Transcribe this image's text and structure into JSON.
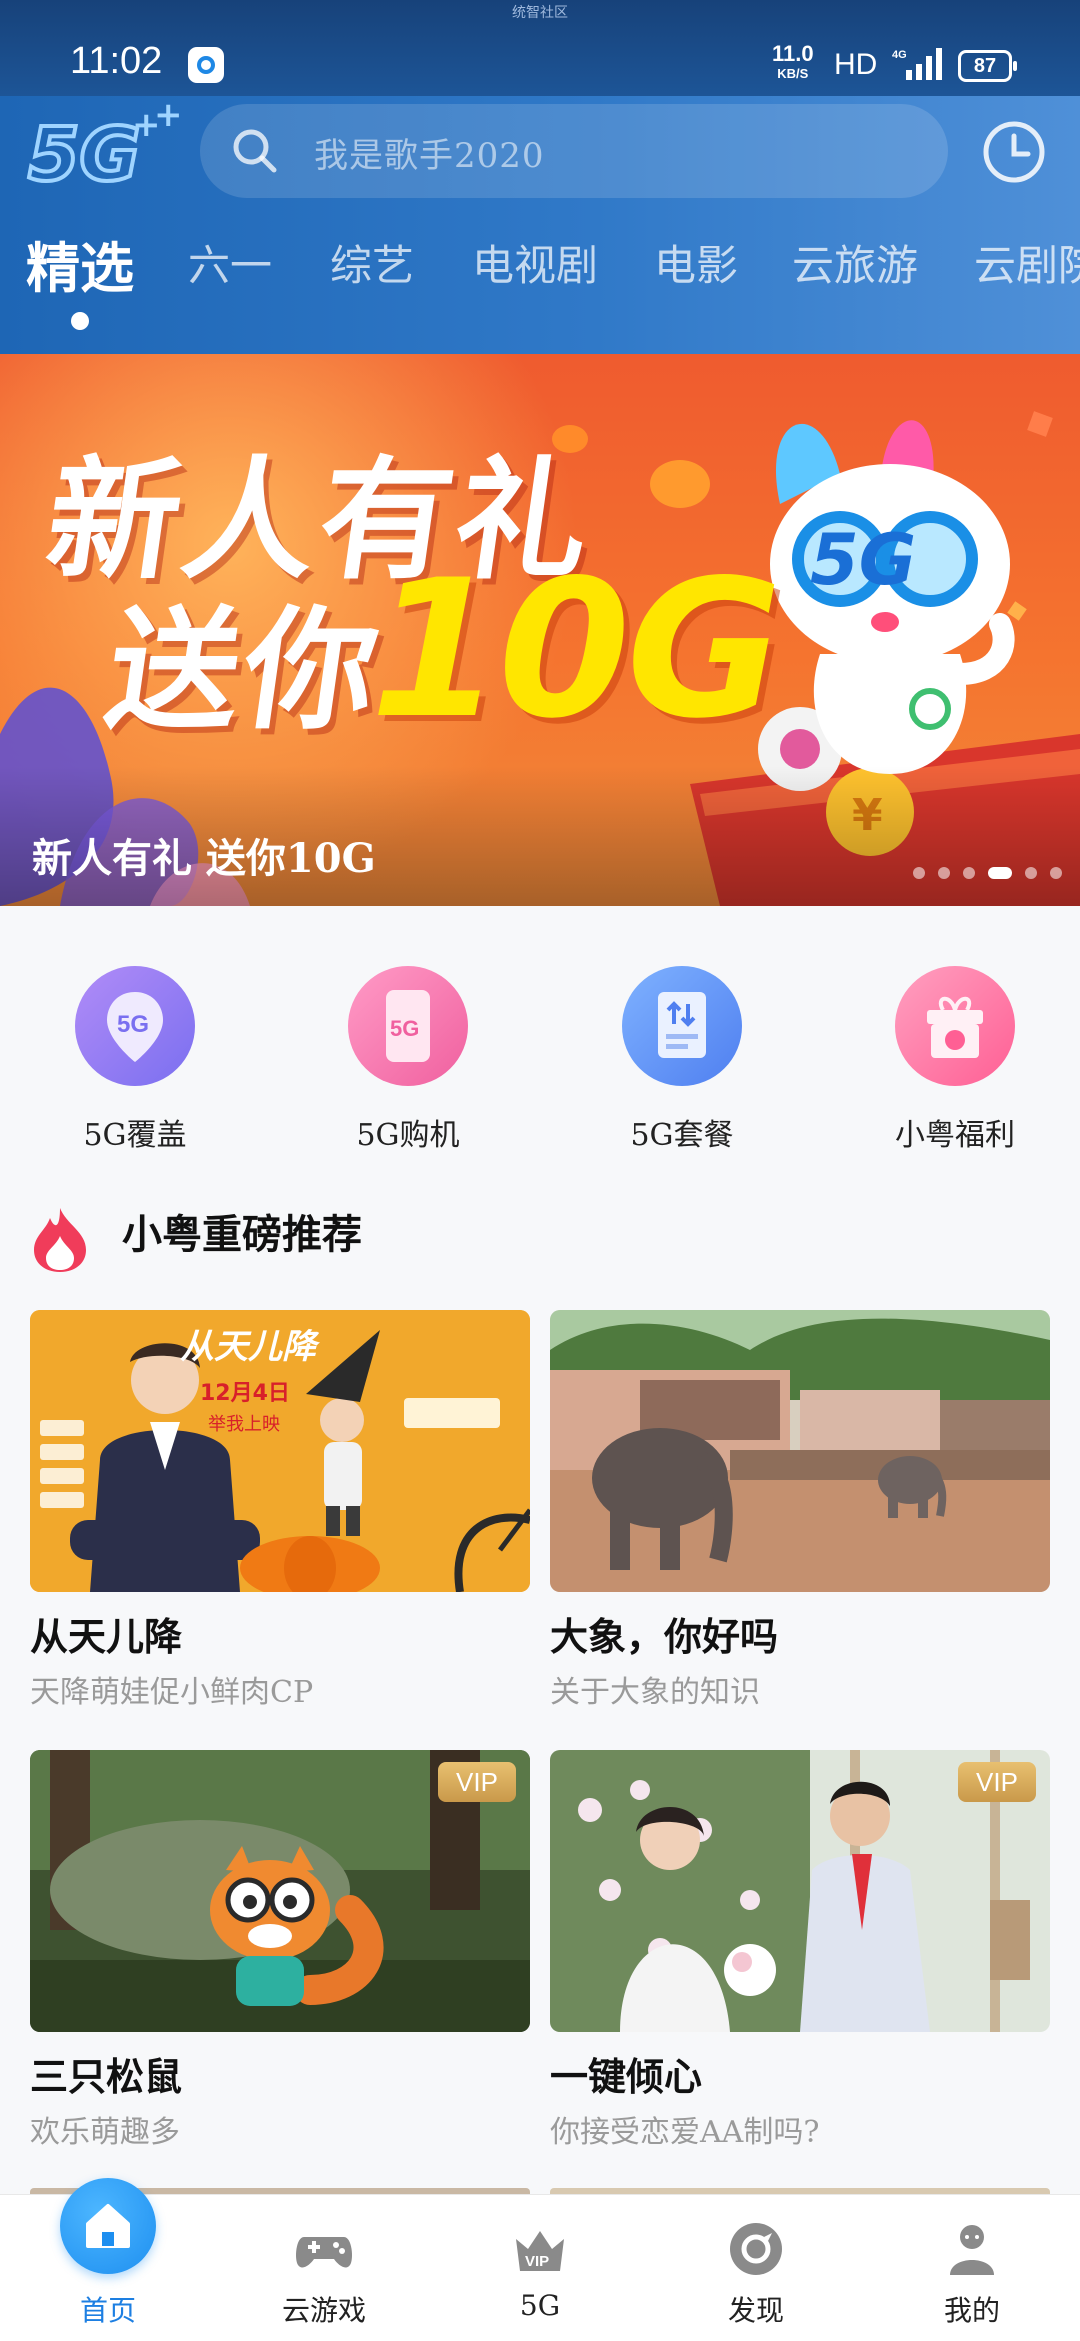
{
  "status_bar": {
    "caption": "统智社区",
    "time": "11:02",
    "net_speed": "11.0",
    "net_unit": "KB/S",
    "hd": "HD",
    "signal": "4G",
    "battery": "87"
  },
  "header": {
    "logo": "5G",
    "search_placeholder": "我是歌手2020",
    "tabs": [
      "精选",
      "六一",
      "综艺",
      "电视剧",
      "电影",
      "云旅游",
      "云剧院"
    ]
  },
  "banner": {
    "line1": "新人有礼",
    "line2": "送你",
    "highlight": "10G",
    "art_5g": "5G",
    "caption": "新人有礼 送你10G",
    "dots_total": 6,
    "active_dot": 4
  },
  "quick_entries": [
    {
      "label": "5G覆盖",
      "icon": "location-5g-icon",
      "color": "#8f7cf0"
    },
    {
      "label": "5G购机",
      "icon": "phone-5g-icon",
      "color": "#f06aa8"
    },
    {
      "label": "5G套餐",
      "icon": "plan-icon",
      "color": "#5b8ff5"
    },
    {
      "label": "小粤福利",
      "icon": "gift-icon",
      "color": "#ff6fa0"
    }
  ],
  "section": {
    "title": "小粤重磅推荐"
  },
  "cards": [
    {
      "title": "从天儿降",
      "subtitle": "天降萌娃促小鲜肉CP",
      "vip": false,
      "poster_title": "从天儿降",
      "poster_date": "12月4日",
      "poster_note": "举我上映"
    },
    {
      "title": "大象，你好吗",
      "subtitle": "关于大象的知识",
      "vip": false
    },
    {
      "title": "三只松鼠",
      "subtitle": "欢乐萌趣多",
      "vip": true,
      "vip_label": "VIP"
    },
    {
      "title": "一键倾心",
      "subtitle": "你接受恋爱AA制吗?",
      "vip": true,
      "vip_label": "VIP"
    }
  ],
  "bottom_nav": [
    {
      "label": "首页",
      "icon": "home-icon",
      "active": true
    },
    {
      "label": "云游戏",
      "icon": "gamepad-icon",
      "active": false
    },
    {
      "label": "5G",
      "icon": "crown-vip-icon",
      "active": false
    },
    {
      "label": "发现",
      "icon": "discover-icon",
      "active": false
    },
    {
      "label": "我的",
      "icon": "profile-icon",
      "active": false
    }
  ],
  "colors": {
    "header_blue": "#2a72c2",
    "accent": "#1d7fe2",
    "banner_orange": "#f26a30",
    "vip_gold": "#d4a85a"
  }
}
